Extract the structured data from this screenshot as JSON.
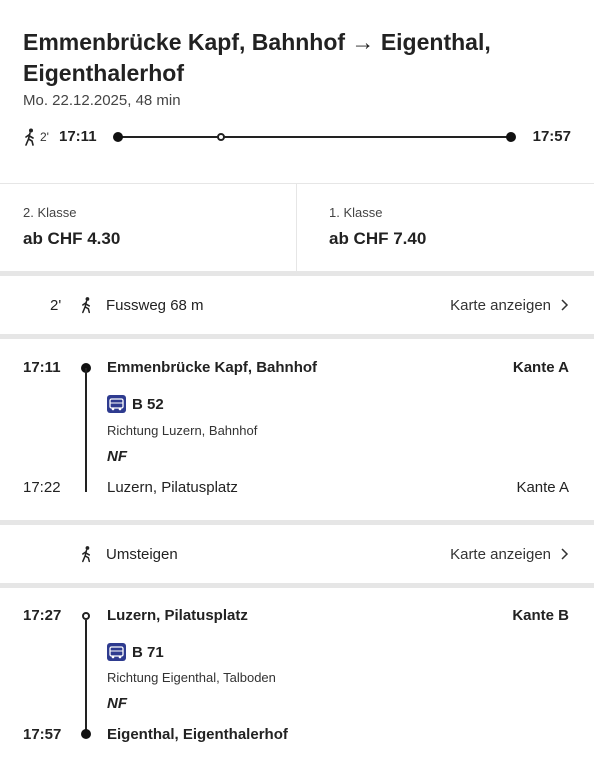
{
  "journey": {
    "title": "Emmenbrücke Kapf, Bahnhof → Eigenthal, Eigenthalerhof",
    "subtitle": "Mo. 22.12.2025, 48 min",
    "walk_minutes": "2'",
    "departure": "17:11",
    "arrival": "17:57"
  },
  "fares": [
    {
      "class_label": "2. Klasse",
      "price": "ab CHF 4.30"
    },
    {
      "class_label": "1. Klasse",
      "price": "ab CHF 7.40"
    }
  ],
  "walk_segment": {
    "minutes": "2'",
    "label": "Fussweg 68 m",
    "map_link": "Karte anzeigen"
  },
  "legs": [
    {
      "dep_time": "17:11",
      "dep_stop": "Emmenbrücke Kapf, Bahnhof",
      "dep_platform": "Kante A",
      "line": "B 52",
      "direction": "Richtung Luzern, Bahnhof",
      "note": "NF",
      "arr_time": "17:22",
      "arr_stop": "Luzern, Pilatusplatz",
      "arr_platform": "Kante A"
    },
    {
      "dep_time": "17:27",
      "dep_stop": "Luzern, Pilatusplatz",
      "dep_platform": "Kante B",
      "line": "B 71",
      "direction": "Richtung Eigenthal, Talboden",
      "note": "NF",
      "arr_time": "17:57",
      "arr_stop": "Eigenthal, Eigenthalerhof"
    }
  ],
  "transfer": {
    "label": "Umsteigen",
    "map_link": "Karte anzeigen"
  },
  "colors": {
    "text": "#222222",
    "bus_badge": "#2e3b8f",
    "divider": "#e6e6e6"
  },
  "icons": {
    "walk": "walking-person-icon",
    "bus": "bus-icon",
    "chevron": "chevron-right-icon"
  }
}
